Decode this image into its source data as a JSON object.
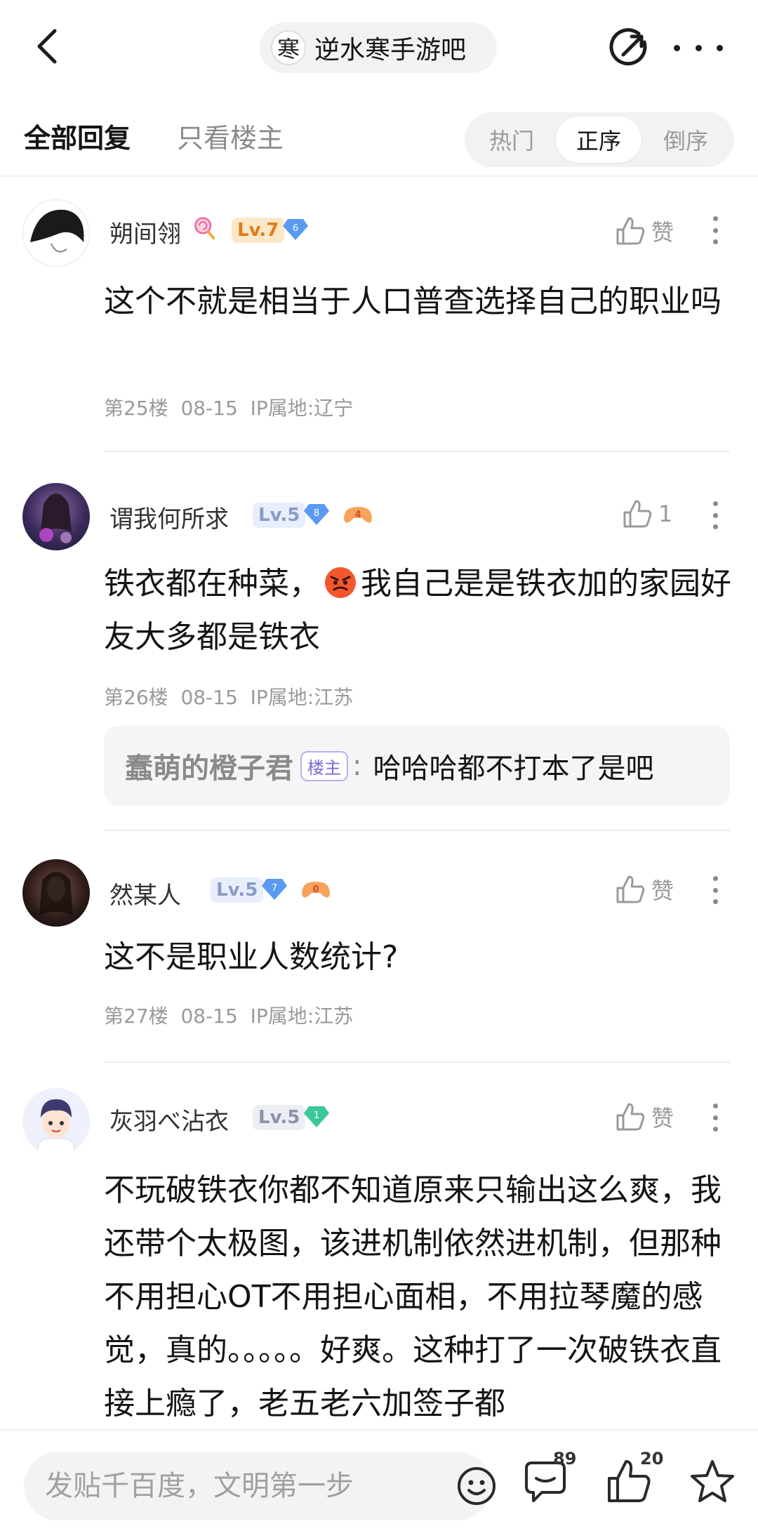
{
  "header": {
    "forum_name": "逆水寒手游吧",
    "forum_avatar_glyph": "寒"
  },
  "tabs": {
    "all_replies": "全部回复",
    "only_op": "只看楼主"
  },
  "sort": {
    "options": [
      "热门",
      "正序",
      "倒序"
    ],
    "selected": "正序"
  },
  "posts": [
    {
      "username": "朔间翎",
      "level": "Lv.7",
      "gem_level": "6",
      "like_label": "赞",
      "content": "这个不就是相当于人口普查选择自己的职业吗",
      "floor": "第25楼",
      "date": "08-15",
      "ip": "IP属地:辽宁"
    },
    {
      "username": "谓我何所求",
      "level": "Lv.5",
      "gem_level": "8",
      "badge_num": "4",
      "like_label": "1",
      "content_before_emoji": "铁衣都在种菜，",
      "content_after_emoji": "我自己是是铁衣加的家园好友大多都是铁衣",
      "floor": "第26楼",
      "date": "08-15",
      "ip": "IP属地:江苏",
      "reply": {
        "name": "蠢萌的橙子君",
        "tag": "楼主",
        "colon": ":",
        "text": "哈哈哈都不打本了是吧"
      }
    },
    {
      "username": "然某人",
      "level": "Lv.5",
      "gem_level": "7",
      "badge_num": "0",
      "like_label": "赞",
      "content": "这不是职业人数统计?",
      "floor": "第27楼",
      "date": "08-15",
      "ip": "IP属地:江苏"
    },
    {
      "username": "灰羽べ沾衣",
      "level": "Lv.5",
      "gem_level": "1",
      "like_label": "赞",
      "content": "不玩破铁衣你都不知道原来只输出这么爽，我还带个太极图，该进机制依然进机制，但那种不用担心OT不用担心面相，不用拉琴魔的感觉，真的。。。。。好爽。这种打了一次破铁衣直接上瘾了，老五老六加签子都"
    }
  ],
  "bottom": {
    "input_placeholder": "发贴千百度，文明第一步",
    "comment_count": "89",
    "like_count": "20"
  },
  "colors": {
    "accent_blue": "#4d8ef7",
    "level_orange": "#e07a1a",
    "op_tag_purple": "#7a6bd6"
  }
}
